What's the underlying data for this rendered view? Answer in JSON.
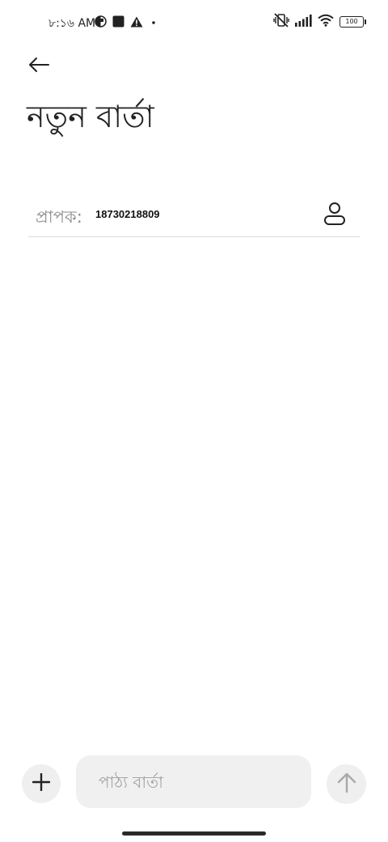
{
  "status_bar": {
    "time": "৮:১৬ AM",
    "battery_level": "100",
    "icons_left": [
      "data-saver-icon",
      "stop-square-icon",
      "warning-icon",
      "dot-icon"
    ],
    "icons_right": [
      "vibrate-off-icon",
      "signal-icon",
      "wifi-icon",
      "battery-icon"
    ]
  },
  "header": {
    "back_icon": "arrow-left-icon",
    "title": "নতুন বার্তা"
  },
  "recipient": {
    "label": "প্রাপক:",
    "value": "18730218809",
    "contact_icon": "person-icon"
  },
  "composer": {
    "attach_icon": "plus-icon",
    "placeholder": "পাঠ্য বার্তা",
    "value": "",
    "send_icon": "arrow-up-icon"
  },
  "colors": {
    "text_primary": "#222222",
    "text_secondary": "#8a8a8a",
    "placeholder": "#a2a2a2",
    "field_background": "#f0f0f0",
    "button_background": "#efefef",
    "divider": "#dcdcdc",
    "send_icon_disabled": "#a9a9a9"
  }
}
